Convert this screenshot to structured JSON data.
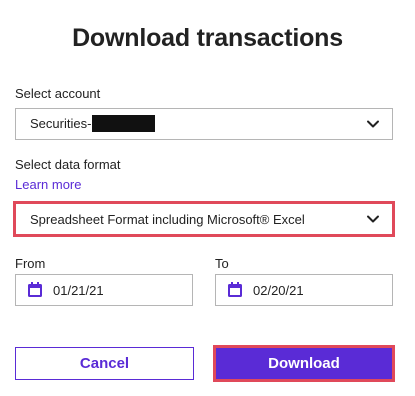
{
  "dialog": {
    "title": "Download transactions"
  },
  "account": {
    "label": "Select account",
    "value": "Securities-"
  },
  "format": {
    "label": "Select data format",
    "learn_more": "Learn more",
    "value": "Spreadsheet Format including Microsoft® Excel"
  },
  "dates": {
    "from_label": "From",
    "from_value": "01/21/21",
    "to_label": "To",
    "to_value": "02/20/21"
  },
  "buttons": {
    "cancel": "Cancel",
    "download": "Download"
  },
  "colors": {
    "accent": "#5a2bd6",
    "highlight": "#e0495a"
  },
  "icons": {
    "select_chevron": "chevron-down-icon",
    "date": "calendar-icon"
  }
}
